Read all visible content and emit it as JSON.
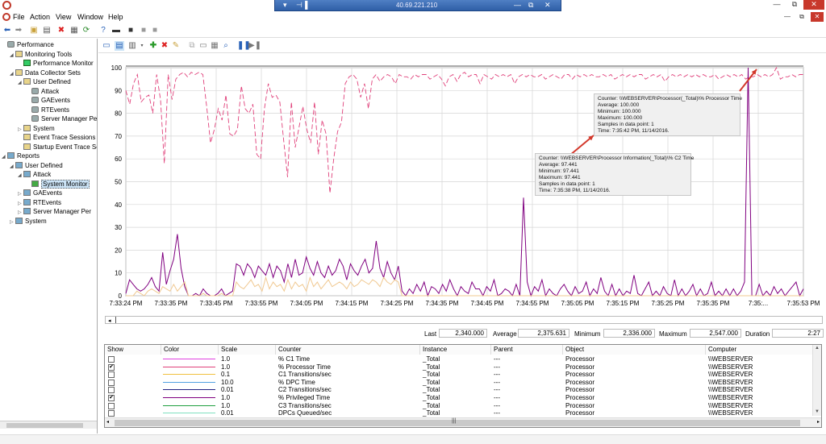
{
  "rdp": {
    "address": "40.69.221.210"
  },
  "menu": [
    "File",
    "Action",
    "View",
    "Window",
    "Help"
  ],
  "tree": [
    {
      "label": "Performance",
      "level": 0,
      "exp": "",
      "icon": "gear",
      "name": "tree-performance"
    },
    {
      "label": "Monitoring Tools",
      "level": 1,
      "exp": "◢",
      "icon": "folder",
      "name": "tree-monitoring-tools"
    },
    {
      "label": "Performance Monitor",
      "level": 2,
      "exp": "",
      "icon": "mon",
      "name": "tree-performance-monitor"
    },
    {
      "label": "Data Collector Sets",
      "level": 1,
      "exp": "◢",
      "icon": "folder",
      "name": "tree-data-collector-sets"
    },
    {
      "label": "User Defined",
      "level": 2,
      "exp": "◢",
      "icon": "folder",
      "name": "tree-dcs-user-defined"
    },
    {
      "label": "Attack",
      "level": 3,
      "exp": "",
      "icon": "gear",
      "name": "tree-dcs-attack"
    },
    {
      "label": "GAEvents",
      "level": 3,
      "exp": "",
      "icon": "gear",
      "name": "tree-dcs-gaevents"
    },
    {
      "label": "RTEvents",
      "level": 3,
      "exp": "",
      "icon": "gear",
      "name": "tree-dcs-rtevents"
    },
    {
      "label": "Server Manager Per",
      "level": 3,
      "exp": "",
      "icon": "gear",
      "name": "tree-dcs-server-manager"
    },
    {
      "label": "System",
      "level": 2,
      "exp": "▷",
      "icon": "folder",
      "name": "tree-dcs-system"
    },
    {
      "label": "Event Trace Sessions",
      "level": 2,
      "exp": "",
      "icon": "folder",
      "name": "tree-event-trace-sessions"
    },
    {
      "label": "Startup Event Trace Ses",
      "level": 2,
      "exp": "",
      "icon": "folder",
      "name": "tree-startup-event-trace"
    },
    {
      "label": "Reports",
      "level": 0,
      "exp": "◢",
      "icon": "rep",
      "name": "tree-reports"
    },
    {
      "label": "User Defined",
      "level": 1,
      "exp": "◢",
      "icon": "rep",
      "name": "tree-rep-user-defined"
    },
    {
      "label": "Attack",
      "level": 2,
      "exp": "◢",
      "icon": "rep",
      "name": "tree-rep-attack"
    },
    {
      "label": "System Monitor",
      "level": 3,
      "exp": "",
      "icon": "sel",
      "name": "tree-rep-system-monitor",
      "selected": true
    },
    {
      "label": "GAEvents",
      "level": 2,
      "exp": "▷",
      "icon": "rep",
      "name": "tree-rep-gaevents"
    },
    {
      "label": "RTEvents",
      "level": 2,
      "exp": "▷",
      "icon": "rep",
      "name": "tree-rep-rtevents"
    },
    {
      "label": "Server Manager Per",
      "level": 2,
      "exp": "▷",
      "icon": "rep",
      "name": "tree-rep-server-manager"
    },
    {
      "label": "System",
      "level": 1,
      "exp": "▷",
      "icon": "rep",
      "name": "tree-rep-system"
    }
  ],
  "stats": {
    "last_label": "Last",
    "last": "2,340.000",
    "average_label": "Average",
    "average": "2,375.631",
    "minimum_label": "Minimum",
    "minimum": "2,336.000",
    "maximum_label": "Maximum",
    "maximum": "2,547.000",
    "duration_label": "Duration",
    "duration": "2:27"
  },
  "legend": {
    "headers": [
      "Show",
      "Color",
      "Scale",
      "Counter",
      "Instance",
      "Parent",
      "Object",
      "Computer"
    ],
    "rows": [
      {
        "show": false,
        "color": "#e040e0",
        "scale": "1.0",
        "counter": "% C1 Time",
        "instance": "_Total",
        "parent": "---",
        "object": "Processor",
        "computer": "\\\\WEBSERVER"
      },
      {
        "show": true,
        "color": "#e0407a",
        "scale": "1.0",
        "counter": "% Processor Time",
        "instance": "_Total",
        "parent": "---",
        "object": "Processor",
        "computer": "\\\\WEBSERVER"
      },
      {
        "show": false,
        "color": "#f0c040",
        "scale": "0.1",
        "counter": "C1 Transitions/sec",
        "instance": "_Total",
        "parent": "---",
        "object": "Processor",
        "computer": "\\\\WEBSERVER"
      },
      {
        "show": false,
        "color": "#50a0e0",
        "scale": "10.0",
        "counter": "% DPC Time",
        "instance": "_Total",
        "parent": "---",
        "object": "Processor",
        "computer": "\\\\WEBSERVER"
      },
      {
        "show": false,
        "color": "#202080",
        "scale": "0.01",
        "counter": "C2 Transitions/sec",
        "instance": "_Total",
        "parent": "---",
        "object": "Processor",
        "computer": "\\\\WEBSERVER"
      },
      {
        "show": true,
        "color": "#800080",
        "scale": "1.0",
        "counter": "% Privileged Time",
        "instance": "_Total",
        "parent": "---",
        "object": "Processor",
        "computer": "\\\\WEBSERVER"
      },
      {
        "show": false,
        "color": "#20a040",
        "scale": "1.0",
        "counter": "C3 Transitions/sec",
        "instance": "_Total",
        "parent": "---",
        "object": "Processor",
        "computer": "\\\\WEBSERVER"
      },
      {
        "show": false,
        "color": "#80e0c0",
        "scale": "0.01",
        "counter": "DPCs Queued/sec",
        "instance": "_Total",
        "parent": "---",
        "object": "Processor",
        "computer": "\\\\WEBSERVER"
      }
    ]
  },
  "tooltips": [
    {
      "name": "tooltip-processor-time",
      "lines": [
        "Counter: \\\\WEBSERVER\\Processor(_Total)\\% Processor Time",
        "Average: 100.000",
        "Minimum: 100.000",
        "Maximum: 100.000",
        "Samples in data point:  1",
        "Time:    7:35:42 PM, 11/14/2016."
      ]
    },
    {
      "name": "tooltip-c2-time",
      "lines": [
        "Counter: \\\\WEBSERVER\\Processor Information(_Total)\\% C2 Time",
        "Average: 97.441",
        "Minimum: 97.441",
        "Maximum: 97.441",
        "Samples in data point:  1",
        "Time:    7:35:38 PM, 11/14/2016."
      ]
    }
  ],
  "chart_data": {
    "type": "line",
    "ylim": [
      0,
      100
    ],
    "yticks": [
      0,
      10,
      20,
      30,
      40,
      50,
      60,
      70,
      80,
      90,
      100
    ],
    "xtick_labels": [
      "7:33:24 PM",
      "7:33:35 PM",
      "7:33:45 PM",
      "7:33:55 PM",
      "7:34:05 PM",
      "7:34:15 PM",
      "7:34:25 PM",
      "7:34:35 PM",
      "7:34:45 PM",
      "7:34:55 PM",
      "7:35:05 PM",
      "7:35:15 PM",
      "7:35:25 PM",
      "7:35:35 PM",
      "7:35:...",
      "7:35:53 PM"
    ],
    "series": [
      {
        "color": "#e0407a",
        "dashed": true,
        "values": [
          90,
          84,
          93,
          97,
          85,
          87,
          88,
          80,
          97,
          86,
          58,
          97,
          86,
          95,
          97,
          98,
          96,
          98,
          97,
          98,
          97,
          83,
          67,
          73,
          82,
          77,
          88,
          71,
          70,
          73,
          92,
          82,
          80,
          84,
          62,
          60,
          82,
          93,
          87,
          88,
          85,
          68,
          52,
          85,
          65,
          74,
          83,
          73,
          67,
          85,
          62,
          77,
          71,
          45,
          60,
          72,
          76,
          93,
          96,
          97,
          95,
          87,
          93,
          82,
          95,
          97,
          94,
          96,
          97,
          96,
          93,
          97,
          96,
          96,
          95,
          97,
          96,
          97,
          97,
          95,
          96,
          97,
          95,
          92,
          96,
          97,
          94,
          97,
          98,
          96,
          97,
          97,
          93,
          97,
          96,
          95,
          97,
          96,
          97,
          96,
          97,
          93,
          96,
          97,
          96,
          97,
          96,
          96,
          97,
          95,
          96,
          97,
          96,
          95,
          97,
          97,
          95,
          97,
          96,
          97,
          96,
          97,
          96,
          96,
          97,
          96,
          97,
          95,
          96,
          97,
          96,
          97,
          96,
          97,
          97,
          95,
          96,
          97,
          96,
          97,
          94,
          96,
          97,
          96,
          97,
          96,
          97,
          96,
          97,
          96,
          97,
          96,
          96,
          97,
          95,
          96,
          97,
          96,
          97,
          96,
          97,
          95,
          96,
          96,
          97,
          96,
          97,
          96,
          97,
          100,
          95,
          96,
          96,
          97,
          96,
          97,
          97
        ]
      },
      {
        "color": "#800080",
        "dashed": false,
        "values": [
          1,
          7,
          5,
          3,
          2,
          3,
          5,
          8,
          4,
          2,
          19,
          5,
          11,
          16,
          27,
          12,
          4,
          0,
          0,
          1,
          0,
          3,
          1,
          0,
          0,
          1,
          3,
          0,
          1,
          2,
          14,
          13,
          9,
          14,
          12,
          8,
          13,
          11,
          9,
          14,
          8,
          13,
          11,
          6,
          14,
          8,
          16,
          9,
          10,
          17,
          12,
          9,
          15,
          10,
          8,
          13,
          9,
          11,
          16,
          13,
          7,
          14,
          11,
          9,
          13,
          16,
          10,
          12,
          24,
          12,
          8,
          15,
          10,
          7,
          13,
          2,
          0,
          3,
          1,
          5,
          2,
          6,
          0,
          4,
          3,
          1,
          5,
          2,
          7,
          3,
          0,
          4,
          2,
          1,
          6,
          3,
          3,
          0,
          4,
          2,
          7,
          0,
          1,
          3,
          2,
          0,
          5,
          0,
          43,
          6,
          0,
          4,
          2,
          7,
          0,
          3,
          1,
          0,
          3,
          5,
          2,
          0,
          4,
          1,
          2,
          6,
          0,
          3,
          1,
          8,
          2,
          0,
          5,
          0,
          3,
          0,
          2,
          1,
          9,
          1,
          0,
          3,
          6,
          0,
          2,
          0,
          4,
          1,
          0,
          7,
          0,
          3,
          0,
          2,
          5,
          0,
          3,
          0,
          1,
          6,
          0,
          2,
          0,
          3,
          0,
          3,
          0,
          2,
          6,
          100,
          0,
          0,
          5,
          0,
          2,
          0,
          4,
          1,
          3,
          0,
          2,
          4,
          6,
          0,
          3
        ]
      },
      {
        "color": "#f0c890",
        "dashed": false,
        "values": [
          0,
          0,
          0,
          2,
          1,
          0,
          2,
          3,
          2,
          1,
          4,
          3,
          2,
          5,
          2,
          4,
          6,
          0,
          0,
          0,
          0,
          1,
          0,
          0,
          0,
          0,
          1,
          0,
          0,
          0,
          6,
          4,
          3,
          5,
          7,
          4,
          5,
          2,
          8,
          3,
          6,
          4,
          5,
          2,
          7,
          3,
          6,
          4,
          5,
          2,
          8,
          4,
          6,
          3,
          5,
          7,
          4,
          5,
          6,
          5,
          3,
          6,
          4,
          5,
          7,
          6,
          5,
          7,
          6,
          4,
          8,
          6,
          5,
          7,
          6,
          0,
          0,
          0,
          0,
          0,
          0,
          0,
          0,
          0,
          0,
          0,
          0,
          0,
          0,
          0,
          0,
          0,
          0,
          0,
          0,
          0,
          0,
          0,
          0,
          0,
          0,
          0,
          0,
          0,
          0,
          0,
          0,
          0,
          0,
          0,
          0,
          0,
          0,
          0,
          0,
          0,
          0,
          0,
          0,
          0,
          0,
          0,
          0,
          0,
          0,
          0,
          0,
          0,
          0,
          0,
          0,
          0,
          0,
          0,
          0,
          0,
          0,
          0,
          0,
          0,
          0,
          0,
          0,
          0,
          0,
          0,
          0,
          0,
          0,
          0,
          0,
          0,
          0,
          0,
          0,
          0,
          0,
          0,
          0,
          0,
          0,
          0,
          0,
          0,
          0,
          0,
          0,
          0,
          0,
          0,
          0,
          0,
          0,
          0,
          0,
          0,
          0,
          0,
          0,
          0,
          0,
          0,
          0,
          0,
          0
        ]
      }
    ]
  }
}
